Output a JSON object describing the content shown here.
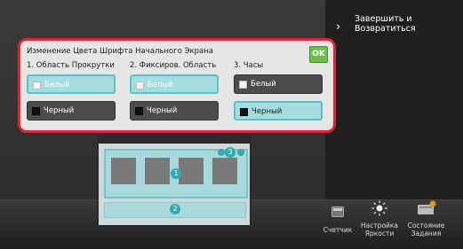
{
  "header": {
    "finish_label": "Завершить и\nВозвратиться"
  },
  "dialog": {
    "title": "Изменение Цвета Шрифта Начального Экрана",
    "ok_label": "OK",
    "columns": [
      {
        "header": "1. Область Прокрутки",
        "white_label": "Белый",
        "black_label": "Черный",
        "selected": "white"
      },
      {
        "header": "2. Фиксиров. Область",
        "white_label": "Белый",
        "black_label": "Черный",
        "selected": "white"
      },
      {
        "header": "3. Часы",
        "white_label": "Белый",
        "black_label": "Черный",
        "selected": "black"
      }
    ]
  },
  "preview": {
    "markers": [
      "1",
      "2",
      "3"
    ]
  },
  "bottom_bar": {
    "items": [
      {
        "label": "Счетчик",
        "icon": "counter-icon"
      },
      {
        "label": "Настройка\nЯркости",
        "icon": "brightness-icon"
      },
      {
        "label": "Состояние\nЗадания",
        "icon": "job-status-icon"
      }
    ]
  }
}
